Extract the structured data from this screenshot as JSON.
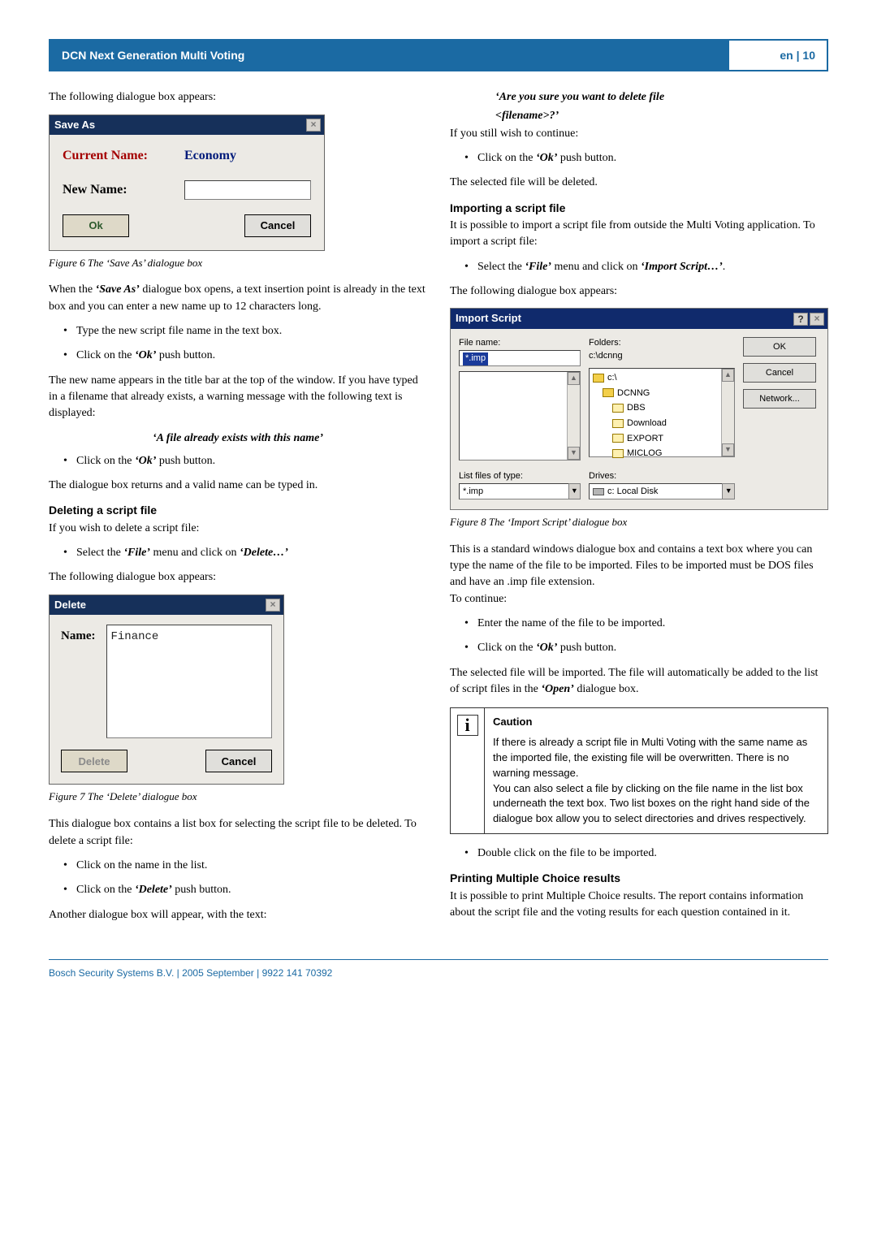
{
  "header": {
    "left": "DCN Next Generation Multi Voting",
    "right": "en | 10"
  },
  "left": {
    "p1": "The following dialogue box appears:",
    "saveas": {
      "title": "Save As",
      "curLabel": "Current Name:",
      "curValue": "Economy",
      "newLabel": "New Name:",
      "ok": "Ok",
      "cancel": "Cancel"
    },
    "fig6": "Figure 6 The ‘Save As’ dialogue box",
    "p2a": "When the ",
    "p2b": "‘Save As’",
    "p2c": " dialogue box opens, a text insertion point is already in the text box and you can enter a new name up to 12 characters long.",
    "b1": "Type the new script file name in the text box.",
    "b2a": "Click on the ",
    "b2b": "‘Ok’",
    "b2c": " push button.",
    "p3": "The new name appears in the title bar at the top of the window. If you have typed in a filename that already exists, a warning message with the following text is displayed:",
    "msg1": "‘A file already exists with this name’",
    "b3a": "Click on the ",
    "b3b": "‘Ok’",
    "b3c": " push button.",
    "p4": "The dialogue box returns and a valid name can be typed in.",
    "h1": "Deleting a script file",
    "p5": "If you wish to delete a script file:",
    "b4a": "Select the ",
    "b4b": "‘File’",
    "b4c": " menu and click on ",
    "b4d": "‘Delete…’",
    "p6": "The following dialogue box appears:",
    "delete": {
      "title": "Delete",
      "nameLabel": "Name:",
      "listValue": "Finance",
      "del": "Delete",
      "cancel": "Cancel"
    },
    "fig7": "Figure 7 The ‘Delete’ dialogue box",
    "p7": "This dialogue box contains a list box for selecting the script file to be deleted. To delete a script file:",
    "b5": "Click on the name in the list.",
    "b6a": "Click on the ",
    "b6b": "‘Delete’",
    "b6c": " push button.",
    "p8": "Another dialogue box will appear, with the text:"
  },
  "right": {
    "msgTop1": "‘Are you sure you want to delete file",
    "msgTop2": "<filename>?’",
    "p1": "If you still wish to continue:",
    "b1a": "Click on the ",
    "b1b": "‘Ok’",
    "b1c": " push button.",
    "p2": "The selected file will be deleted.",
    "h1": "Importing a script file",
    "p3": "It is possible to import a script file from outside the Multi Voting application. To import a script file:",
    "b2a": "Select the ",
    "b2b": "‘File’",
    "b2c": " menu and click on ",
    "b2d": "‘Import Script…’",
    "b2e": ".",
    "p4": "The following dialogue box appears:",
    "import": {
      "title": "Import Script",
      "fileNameLabel": "File name:",
      "fileNameValue": "*.imp",
      "foldersLabel": "Folders:",
      "foldersPath": "c:\\dcnng",
      "ok": "OK",
      "cancel": "Cancel",
      "network": "Network...",
      "tree": [
        "c:\\",
        "DCNNG",
        "DBS",
        "Download",
        "EXPORT",
        "MICLOG"
      ],
      "listTypeLabel": "List files of type:",
      "listTypeValue": "*.imp",
      "drivesLabel": "Drives:",
      "drivesValue": "c: Local Disk"
    },
    "fig8": "Figure 8 The ‘Import Script’ dialogue box",
    "p5": "This is a standard windows dialogue box and contains a text box where you can type the name of the file to be imported. Files to be imported must be DOS files and have an .imp file extension.",
    "p5b": "To continue:",
    "b3": "Enter the name of the file to be imported.",
    "b4a": "Click on the ",
    "b4b": "‘Ok’",
    "b4c": " push button.",
    "p6a": "The selected file will be imported. The file will automatically be added to the list of script files in the ",
    "p6b": "‘Open’",
    "p6c": " dialogue box.",
    "caution": {
      "title": "Caution",
      "text1": "If there is already a script file in Multi Voting with the same name as the imported file, the existing file will be overwritten. There is no warning message.",
      "text2": "You can also select a file by clicking on the file name in the list box underneath the text box. Two list boxes on the right hand side of the dialogue box allow you to select directories and drives respectively."
    },
    "b5": "Double click on the file to be imported.",
    "h2": "Printing Multiple Choice results",
    "p7": "It is possible to print Multiple Choice results. The report contains information about the script file and the voting results for each question contained in it."
  },
  "footer": "Bosch Security Systems B.V. | 2005 September | 9922 141 70392"
}
